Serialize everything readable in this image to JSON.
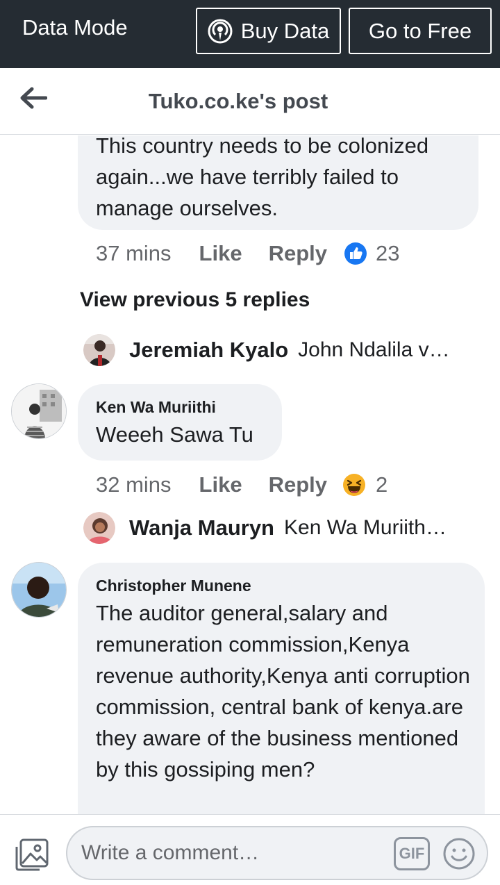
{
  "data_bar": {
    "mode_label": "Data Mode",
    "buy_label": "Buy Data",
    "free_label": "Go to Free"
  },
  "header": {
    "title": "Tuko.co.ke's post"
  },
  "comments": [
    {
      "text": "This country needs to be colonized again...we have terribly failed to manage ourselves.",
      "time": "37 mins",
      "like_label": "Like",
      "reply_label": "Reply",
      "reaction": "like-icon",
      "reaction_count": "23"
    },
    {
      "author": "Ken Wa Muriithi",
      "text": "Weeeh Sawa Tu",
      "time": "32 mins",
      "like_label": "Like",
      "reply_label": "Reply",
      "reaction": "haha-icon",
      "reaction_count": "2"
    },
    {
      "author": "Christopher Munene",
      "text": "The auditor general,salary and remuneration commission,Kenya revenue authority,Kenya anti corruption commission, central bank of kenya.are they aware of the business mentioned by this gossiping men?"
    }
  ],
  "view_previous_label": "View previous 5 replies",
  "reply_previews": [
    {
      "name": "Jeremiah Kyalo",
      "preview": "John Ndalila v…"
    },
    {
      "name": "Wanja Mauryn",
      "preview": "Ken Wa Muriith…"
    }
  ],
  "composer": {
    "placeholder": "Write a comment…",
    "gif_label": "GIF"
  },
  "colors": {
    "top_bar": "#252c33",
    "bubble": "#f0f2f5",
    "muted_text": "#65676b",
    "like_blue": "#1877f2"
  }
}
